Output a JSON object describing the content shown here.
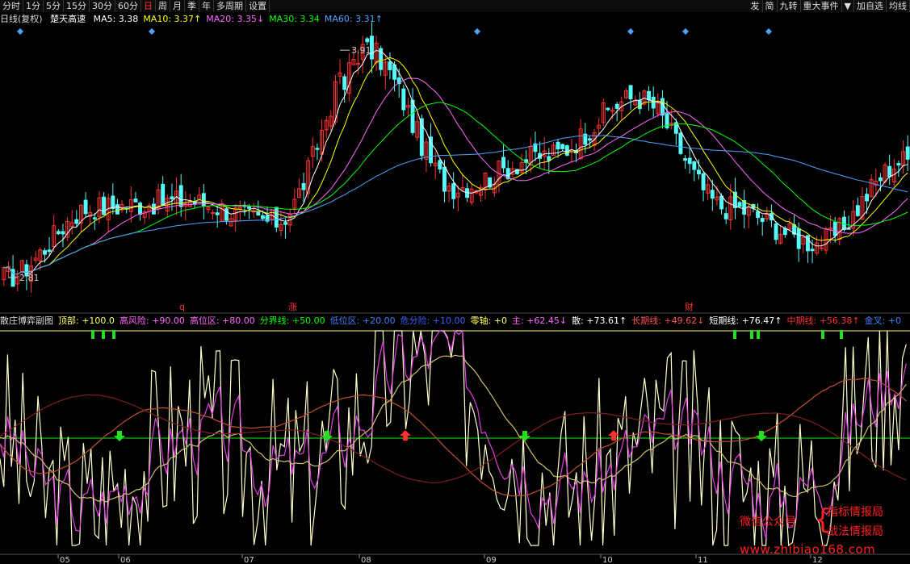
{
  "toolbar": {
    "periods": [
      "分时",
      "1分",
      "5分",
      "15分",
      "30分",
      "60分",
      "日",
      "周",
      "月",
      "季",
      "年",
      "多周期",
      "设置"
    ],
    "active_period": "日",
    "right_buttons": [
      "发",
      "简",
      "九转",
      "重大事件",
      "▼",
      "加自选",
      "均线"
    ]
  },
  "main_legend": {
    "title": "日线(复权)",
    "stock_name": "楚天高速",
    "ma": [
      {
        "label": "MA5: 3.38",
        "color": "#ffffff"
      },
      {
        "label": "MA10: 3.37↑",
        "color": "#ffff00"
      },
      {
        "label": "MA20: 3.35↓",
        "color": "#ff66ff"
      },
      {
        "label": "MA30: 3.34",
        "color": "#00ff00"
      },
      {
        "label": "MA60: 3.31↑",
        "color": "#4fa3ff"
      }
    ]
  },
  "price_annotations": {
    "high": "3.91",
    "low": "2.81"
  },
  "event_markers": [
    "q",
    "涨",
    "财"
  ],
  "sub_legend": {
    "items": [
      {
        "label": "散庄博弈副图",
        "color": "#dddddd"
      },
      {
        "label": "顶部: +100.0",
        "color": "#ffff66"
      },
      {
        "label": "高风险: +90.00",
        "color": "#ff66ff"
      },
      {
        "label": "高位区: +80.00",
        "color": "#ff66ff"
      },
      {
        "label": "分界线: +50.00",
        "color": "#00ff00"
      },
      {
        "label": "低位区: +20.00",
        "color": "#3a7fff"
      },
      {
        "label": "危分险: +10.00",
        "color": "#3a5fff"
      },
      {
        "label": "零轴: +0",
        "color": "#ffff66"
      },
      {
        "label": "主: +62.45↓",
        "color": "#ff66ff"
      },
      {
        "label": "散: +73.61↑",
        "color": "#ffffff"
      },
      {
        "label": "长期线: +49.62↓",
        "color": "#ff5050"
      },
      {
        "label": "短期线: +76.47↑",
        "color": "#ffffff"
      },
      {
        "label": "中期线: +56.38↑",
        "color": "#ff3030"
      },
      {
        "label": "金叉: +0",
        "color": "#3a7fff"
      }
    ]
  },
  "x_axis": {
    "months": [
      "05",
      "06",
      "07",
      "08",
      "09",
      "10",
      "11",
      "12"
    ]
  },
  "watermark": {
    "wechat": "微信公众号",
    "line1": "指标情报局",
    "line2": "战法情报局",
    "url": "www.zhibiao168.com"
  },
  "chart_data": [
    {
      "type": "candlestick",
      "title": "楚天高速 日线(复权)",
      "y_annotated_high": 3.91,
      "y_annotated_low": 2.81,
      "ma_current": {
        "MA5": 3.38,
        "MA10": 3.37,
        "MA20": 3.35,
        "MA30": 3.34,
        "MA60": 3.31
      },
      "price_path_key_points": [
        {
          "date_approx": "05 start",
          "price": 2.81
        },
        {
          "date_approx": "05 mid",
          "price": 3.15
        },
        {
          "date_approx": "06 early",
          "price": 3.18
        },
        {
          "date_approx": "07",
          "price": 3.08
        },
        {
          "date_approx": "07 late",
          "price": 3.91
        },
        {
          "date_approx": "08 early",
          "price": 3.25
        },
        {
          "date_approx": "08 late",
          "price": 3.4
        },
        {
          "date_approx": "09 mid",
          "price": 3.68
        },
        {
          "date_approx": "10",
          "price": 3.15
        },
        {
          "date_approx": "11 early",
          "price": 2.98
        },
        {
          "date_approx": "12",
          "price": 3.38
        }
      ]
    },
    {
      "type": "line",
      "title": "散庄博弈副图",
      "reference_levels": {
        "顶部": 100,
        "高风险": 90,
        "高位区": 80,
        "分界线": 50,
        "低位区": 20,
        "危分险": 10,
        "零轴": 0
      },
      "current": {
        "主": 62.45,
        "散": 73.61,
        "长期线": 49.62,
        "短期线": 76.47,
        "中期线": 56.38,
        "金叉": 0
      },
      "signals": [
        {
          "month": "05",
          "type": "sell"
        },
        {
          "month": "07",
          "type": "sell"
        },
        {
          "month": "08",
          "type": "buy"
        },
        {
          "month": "09",
          "type": "sell"
        },
        {
          "month": "10",
          "type": "buy"
        },
        {
          "month": "11",
          "type": "sell"
        }
      ]
    }
  ]
}
